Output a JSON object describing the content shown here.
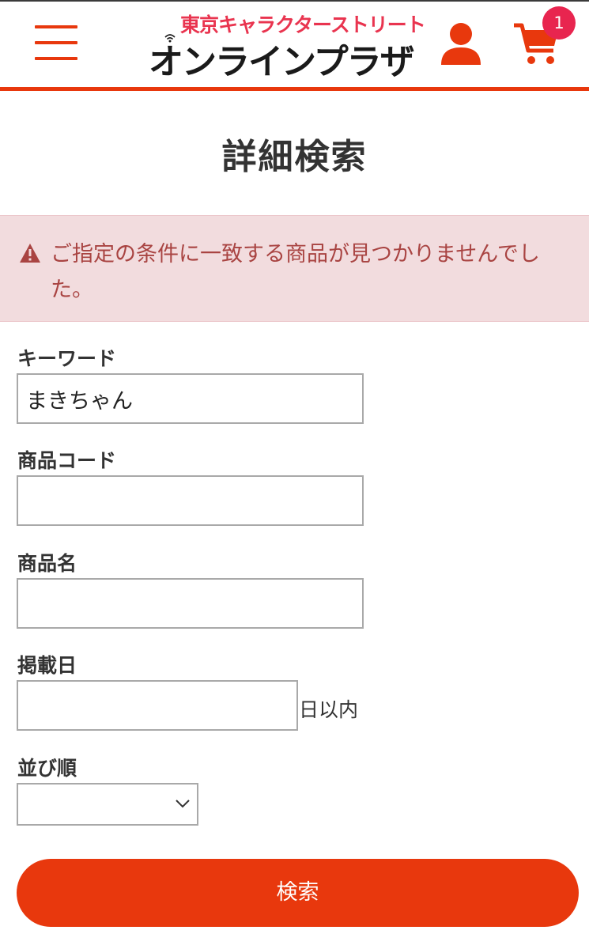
{
  "header": {
    "logo_top": "東京キャラクターストリート",
    "logo_bottom": "オンラインプラザ",
    "cart_count": "1"
  },
  "page_title": "詳細検索",
  "alert": {
    "message": "ご指定の条件に一致する商品が見つかりませんでした。"
  },
  "form": {
    "keyword_label": "キーワード",
    "keyword_value": "まきちゃん",
    "product_code_label": "商品コード",
    "product_code_value": "",
    "product_name_label": "商品名",
    "product_name_value": "",
    "posted_date_label": "掲載日",
    "posted_date_value": "",
    "posted_date_suffix": "日以内",
    "sort_label": "並び順",
    "sort_value": "",
    "submit_label": "検索"
  },
  "colors": {
    "brand_accent": "#e8380d",
    "logo_pink": "#e9344f",
    "badge": "#e8254f",
    "alert_bg": "#f2dcde",
    "alert_text": "#a94442"
  },
  "icons": {
    "menu": "hamburger-menu-icon",
    "account": "user-icon",
    "cart": "shopping-cart-icon",
    "warning": "warning-triangle-icon",
    "select": "chevron-down-icon"
  }
}
